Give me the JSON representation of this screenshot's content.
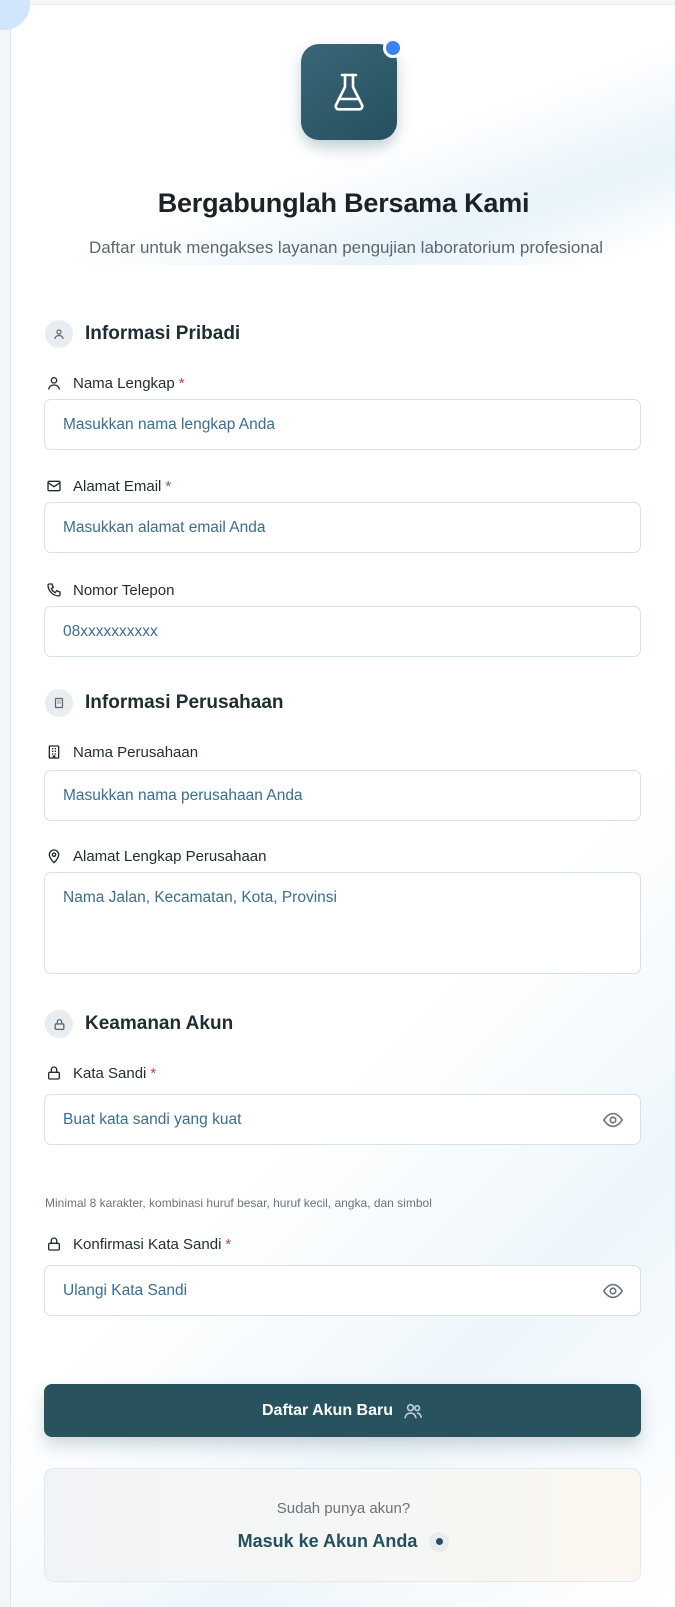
{
  "header": {
    "title": "Bergabunglah Bersama Kami",
    "subtitle": "Daftar untuk mengakses layanan pengujian laboratorium profesional"
  },
  "sections": {
    "personal": "Informasi Pribadi",
    "company": "Informasi Perusahaan",
    "security": "Keamanan Akun"
  },
  "fields": {
    "full_name": {
      "label": "Nama Lengkap",
      "required": "*",
      "placeholder": "Masukkan nama lengkap Anda"
    },
    "email": {
      "label": "Alamat Email",
      "required": "*",
      "placeholder": "Masukkan alamat email Anda"
    },
    "phone": {
      "label": "Nomor Telepon",
      "placeholder": "08xxxxxxxxxx"
    },
    "company_name": {
      "label": "Nama Perusahaan",
      "placeholder": "Masukkan nama perusahaan Anda"
    },
    "company_address": {
      "label": "Alamat Lengkap Perusahaan",
      "placeholder": "Nama Jalan, Kecamatan, Kota, Provinsi"
    },
    "password": {
      "label": "Kata Sandi",
      "required": "*",
      "placeholder": "Buat kata sandi yang kuat",
      "hint": "Minimal 8 karakter, kombinasi huruf besar, huruf kecil, angka, dan simbol"
    },
    "confirm_password": {
      "label": "Konfirmasi Kata Sandi",
      "required": "*",
      "placeholder": "Ulangi Kata Sandi"
    }
  },
  "actions": {
    "register_label": "Daftar Akun Baru",
    "login_question": "Sudah punya akun?",
    "login_link": "Masuk ke Akun Anda"
  },
  "icons": {
    "logo": "flask-icon",
    "personal": "user-icon",
    "email": "mail-icon",
    "phone": "phone-icon",
    "company": "building-icon",
    "address": "map-pin-icon",
    "security": "lock-icon",
    "password_toggle": "eye-icon",
    "register": "users-icon"
  },
  "colors": {
    "primary": "#29525f",
    "required": "#e0393b",
    "placeholder": "#3a6e93",
    "badge": "#3b82f6"
  }
}
